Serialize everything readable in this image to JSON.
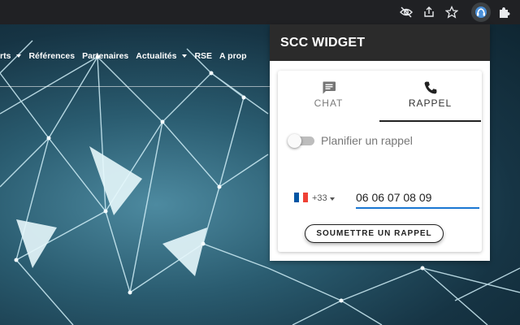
{
  "toolbar": {
    "icons": [
      "eye-off-icon",
      "share-icon",
      "star-icon",
      "extension-active-icon",
      "puzzle-icon"
    ]
  },
  "site_nav": {
    "items": [
      {
        "label": "rts",
        "dropdown": true
      },
      {
        "label": "Références",
        "dropdown": false
      },
      {
        "label": "Partenaires",
        "dropdown": false
      },
      {
        "label": "Actualités",
        "dropdown": true
      },
      {
        "label": "RSE",
        "dropdown": false
      },
      {
        "label": "A prop",
        "dropdown": false
      }
    ]
  },
  "widget": {
    "title": "SCC WIDGET",
    "tabs": [
      {
        "label": "CHAT",
        "icon": "chat-icon",
        "active": false
      },
      {
        "label": "RAPPEL",
        "icon": "phone-icon",
        "active": true
      }
    ],
    "schedule_toggle": {
      "label": "Planifier un rappel",
      "checked": false
    },
    "phone": {
      "country_flag": "fr-flag-icon",
      "dial_code": "+33",
      "value": "06 06 07 08 09"
    },
    "submit_label": "SOUMETTRE UN RAPPEL"
  },
  "colors": {
    "header_bg": "#2b2b2b",
    "accent": "#1976d2",
    "toolbar_bg": "#202124"
  }
}
